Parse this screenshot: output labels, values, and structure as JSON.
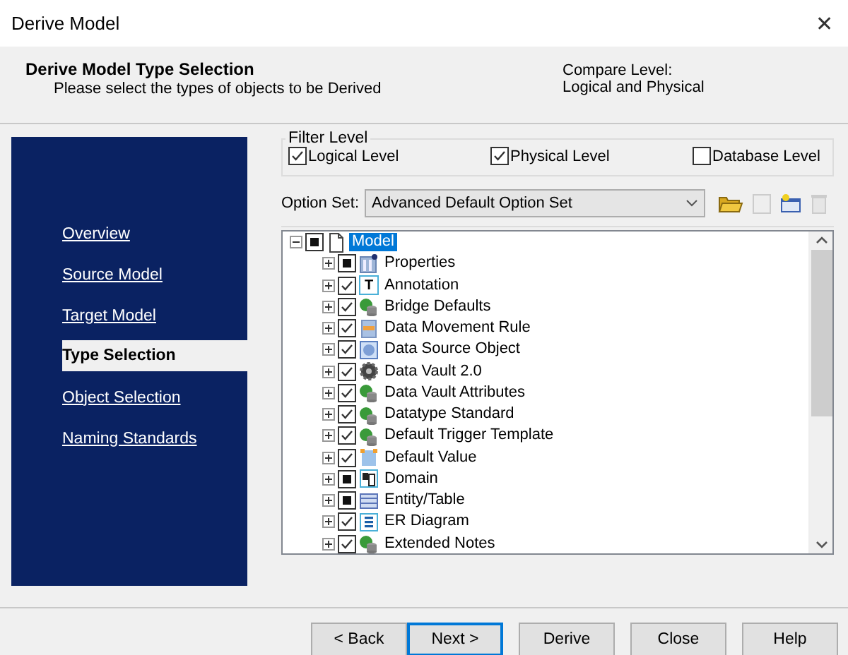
{
  "window": {
    "title": "Derive Model",
    "close": "✕"
  },
  "header": {
    "title": "Derive Model Type Selection",
    "subtitle": "Please select the types of objects to be Derived",
    "compare_label": "Compare Level:",
    "compare_value": "Logical and Physical"
  },
  "sidebar": {
    "items": [
      {
        "label": "Overview",
        "selected": false
      },
      {
        "label": "Source Model",
        "selected": false
      },
      {
        "label": "Target Model",
        "selected": false
      },
      {
        "label": "Type Selection",
        "selected": true
      },
      {
        "label": "Object Selection",
        "selected": false
      },
      {
        "label": "Naming Standards",
        "selected": false
      }
    ]
  },
  "filter_level": {
    "legend": "Filter Level",
    "options": [
      {
        "label": "Logical Level",
        "checked": true
      },
      {
        "label": "Physical Level",
        "checked": true
      },
      {
        "label": "Database Level",
        "checked": false
      }
    ]
  },
  "option_set": {
    "label": "Option Set:",
    "value": "Advanced Default Option Set"
  },
  "tree": [
    {
      "label": "Model",
      "checked": false,
      "partial": true,
      "expanded": true,
      "selected": true,
      "children": [
        {
          "label": "Properties",
          "checked": false,
          "partial": true,
          "expanded": false,
          "selected": false
        },
        {
          "label": "Annotation",
          "checked": true,
          "partial": false,
          "expanded": false,
          "selected": false,
          "icon_text": "T"
        },
        {
          "label": "Bridge Defaults",
          "checked": true,
          "partial": false,
          "expanded": false,
          "selected": false
        },
        {
          "label": "Data Movement Rule",
          "checked": true,
          "partial": false,
          "expanded": false,
          "selected": false
        },
        {
          "label": "Data Source Object",
          "checked": true,
          "partial": false,
          "expanded": false,
          "selected": false
        },
        {
          "label": "Data Vault 2.0",
          "checked": true,
          "partial": false,
          "expanded": false,
          "selected": false
        },
        {
          "label": "Data Vault Attributes",
          "checked": true,
          "partial": false,
          "expanded": false,
          "selected": false
        },
        {
          "label": "Datatype Standard",
          "checked": true,
          "partial": false,
          "expanded": false,
          "selected": false
        },
        {
          "label": "Default Trigger Template",
          "checked": true,
          "partial": false,
          "expanded": false,
          "selected": false
        },
        {
          "label": "Default Value",
          "checked": true,
          "partial": false,
          "expanded": false,
          "selected": false
        },
        {
          "label": "Domain",
          "checked": false,
          "partial": true,
          "expanded": false,
          "selected": false
        },
        {
          "label": "Entity/Table",
          "checked": false,
          "partial": true,
          "expanded": false,
          "selected": false
        },
        {
          "label": "ER Diagram",
          "checked": true,
          "partial": false,
          "expanded": false,
          "selected": false
        },
        {
          "label": "Extended Notes",
          "checked": true,
          "partial": false,
          "expanded": false,
          "selected": false
        }
      ]
    }
  ],
  "buttons": [
    {
      "label": "< Back",
      "default": false
    },
    {
      "label": "Next >",
      "default": true
    },
    {
      "label": "Derive",
      "default": false
    },
    {
      "label": "Close",
      "default": false
    },
    {
      "label": "Help",
      "default": false
    }
  ]
}
